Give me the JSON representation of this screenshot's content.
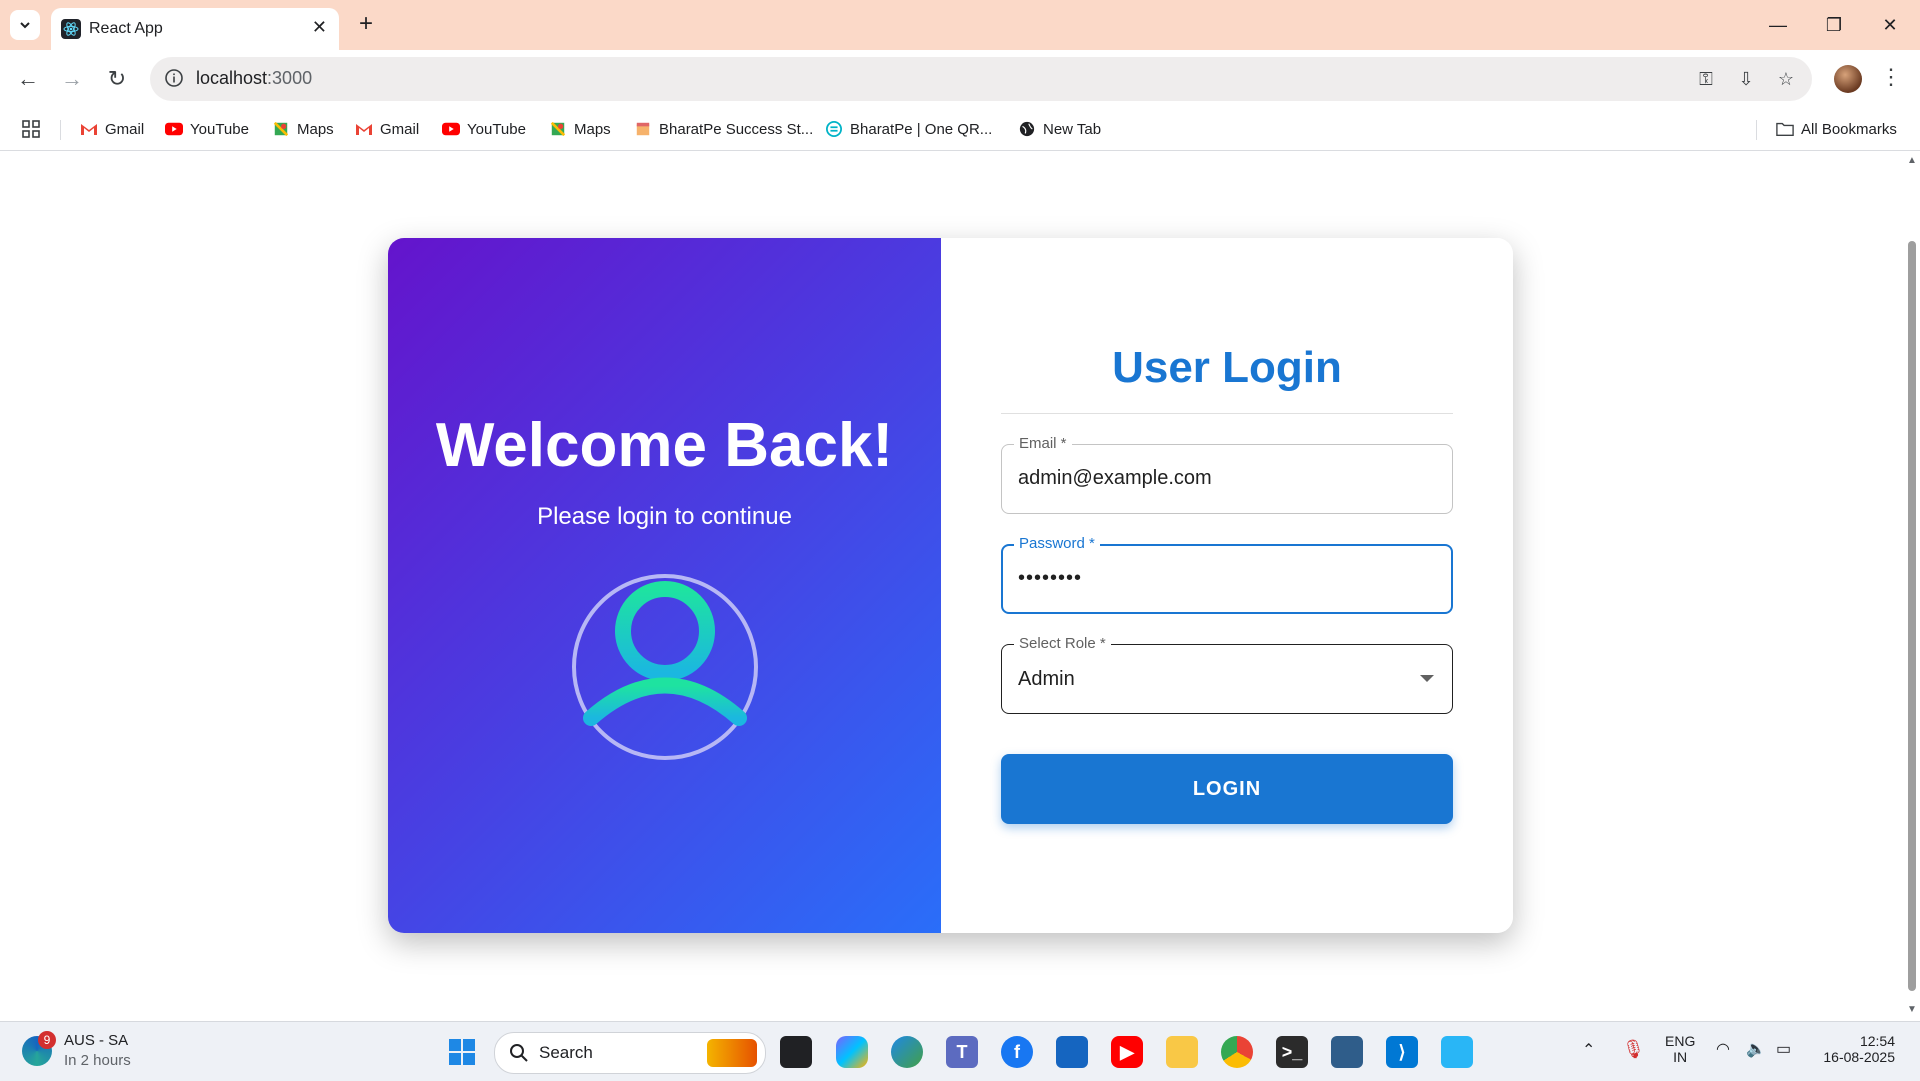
{
  "browser": {
    "tab_title": "React App",
    "url_host": "localhost",
    "url_port": ":3000"
  },
  "bookmarks": [
    {
      "label": "Gmail",
      "icon": "gmail-icon"
    },
    {
      "label": "YouTube",
      "icon": "youtube-icon"
    },
    {
      "label": "Maps",
      "icon": "maps-icon"
    },
    {
      "label": "Gmail",
      "icon": "gmail-icon"
    },
    {
      "label": "YouTube",
      "icon": "youtube-icon"
    },
    {
      "label": "Maps",
      "icon": "maps-icon"
    },
    {
      "label": "BharatPe Success St...",
      "icon": "bharatpe-icon"
    },
    {
      "label": "BharatPe | One QR...",
      "icon": "bharatpe-qr-icon"
    },
    {
      "label": "New Tab",
      "icon": "globe-icon"
    }
  ],
  "bookmarks_all": "All Bookmarks",
  "login": {
    "welcome": "Welcome Back!",
    "subtitle": "Please login to continue",
    "title": "User Login",
    "email_label": "Email *",
    "email_value": "admin@example.com",
    "password_label": "Password *",
    "password_value": "••••••••",
    "role_label": "Select Role *",
    "role_value": "Admin",
    "button": "LOGIN"
  },
  "colors": {
    "primary": "#1976d2",
    "gradient_start": "#6414cc",
    "gradient_end": "#2a6ef9",
    "titlebar": "#fbd9c8"
  },
  "taskbar": {
    "weather_badge": "9",
    "weather_location": "AUS - SA",
    "weather_sub": "In 2 hours",
    "search": "Search",
    "lang_1": "ENG",
    "lang_2": "IN",
    "time": "12:54",
    "date": "16-08-2025"
  }
}
